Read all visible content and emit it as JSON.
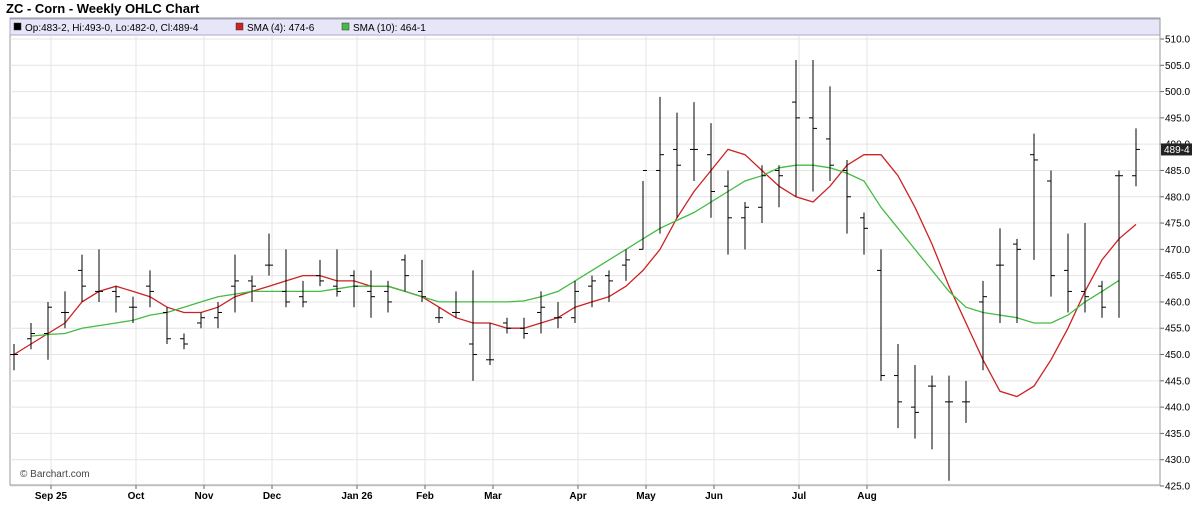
{
  "chart_data": {
    "type": "ohlc",
    "title": "ZC - Corn - Weekly OHLC Chart",
    "legend": [
      {
        "label": "Op:483-2, Hi:493-0, Lo:482-0, Cl:489-4",
        "color": "#000000"
      },
      {
        "label": "SMA (4): 474-6",
        "color": "#cc2222"
      },
      {
        "label": "SMA (10): 464-1",
        "color": "#44bb44"
      }
    ],
    "watermark": "© Barchart.com",
    "last_price_label": "489-4",
    "ylim": [
      425,
      510
    ],
    "yticks": [
      {
        "value": 510,
        "label": "510.0"
      },
      {
        "value": 505,
        "label": "505.0"
      },
      {
        "value": 500,
        "label": "500.0"
      },
      {
        "value": 495,
        "label": "495.0"
      },
      {
        "value": 490,
        "label": "490.0"
      },
      {
        "value": 485,
        "label": "485.0"
      },
      {
        "value": 480,
        "label": "480.0"
      },
      {
        "value": 475,
        "label": "475.0"
      },
      {
        "value": 470,
        "label": "470.0"
      },
      {
        "value": 465,
        "label": "465.0"
      },
      {
        "value": 460,
        "label": "460.0"
      },
      {
        "value": 455,
        "label": "455.0"
      },
      {
        "value": 450,
        "label": "450.0"
      },
      {
        "value": 445,
        "label": "445.0"
      },
      {
        "value": 440,
        "label": "440.0"
      },
      {
        "value": 435,
        "label": "435.0"
      },
      {
        "value": 430,
        "label": "430.0"
      },
      {
        "value": 425,
        "label": "425.0"
      }
    ],
    "xticks": [
      {
        "index": 2,
        "label": "Sep 25"
      },
      {
        "index": 7,
        "label": "Oct"
      },
      {
        "index": 11,
        "label": "Nov"
      },
      {
        "index": 15,
        "label": "Dec"
      },
      {
        "index": 20,
        "label": "Jan 26"
      },
      {
        "index": 24,
        "label": "Feb"
      },
      {
        "index": 28,
        "label": "Mar"
      },
      {
        "index": 33,
        "label": "Apr"
      },
      {
        "index": 37,
        "label": "May"
      },
      {
        "index": 41,
        "label": "Jun"
      },
      {
        "index": 46,
        "label": "Jul"
      },
      {
        "index": 50,
        "label": "Aug"
      }
    ],
    "ohlc": [
      [
        450,
        452,
        447,
        450
      ],
      [
        453,
        456,
        451,
        454
      ],
      [
        454,
        460,
        449,
        459
      ],
      [
        458,
        462,
        455,
        458
      ],
      [
        466,
        469,
        460,
        463
      ],
      [
        462,
        470,
        460,
        462
      ],
      [
        462,
        463,
        458,
        461
      ],
      [
        459,
        461,
        456,
        459
      ],
      [
        463,
        466,
        459,
        462
      ],
      [
        458,
        459,
        452,
        453
      ],
      [
        453,
        454,
        451,
        452
      ],
      [
        456,
        458,
        455,
        457
      ],
      [
        457,
        460,
        455,
        458
      ],
      [
        463,
        469,
        458,
        464
      ],
      [
        464,
        465,
        460,
        463
      ],
      [
        467,
        473,
        465,
        467
      ],
      [
        462,
        470,
        459,
        460
      ],
      [
        461,
        464,
        459,
        460
      ],
      [
        465,
        468,
        463,
        464
      ],
      [
        463,
        470,
        461,
        462
      ],
      [
        465,
        466,
        459,
        463
      ],
      [
        462,
        466,
        457,
        461
      ],
      [
        462,
        464,
        458,
        460
      ],
      [
        468,
        469,
        462,
        465
      ],
      [
        462,
        468,
        460,
        461
      ],
      [
        457,
        459,
        456,
        457
      ],
      [
        458,
        462,
        457,
        458
      ],
      [
        452,
        466,
        445,
        450
      ],
      [
        449,
        456,
        448,
        449
      ],
      [
        456,
        457,
        454,
        455
      ],
      [
        455,
        457,
        453,
        454
      ],
      [
        458,
        462,
        454,
        459
      ],
      [
        457,
        460,
        455,
        457
      ],
      [
        457,
        464,
        456,
        462
      ],
      [
        463,
        465,
        459,
        464
      ],
      [
        465,
        466,
        460,
        464
      ],
      [
        467,
        470,
        464,
        468
      ],
      [
        470,
        483,
        470,
        485
      ],
      [
        485,
        499,
        473,
        488
      ],
      [
        489,
        496,
        476,
        486
      ],
      [
        489,
        498,
        483,
        489
      ],
      [
        488,
        494,
        476,
        481
      ],
      [
        482,
        485,
        469,
        476
      ],
      [
        476,
        479,
        470,
        478
      ],
      [
        478,
        486,
        475,
        484
      ],
      [
        485,
        486,
        478,
        484
      ],
      [
        498,
        506,
        480,
        495
      ],
      [
        495,
        506,
        481,
        493
      ],
      [
        491,
        501,
        483,
        486
      ],
      [
        485,
        487,
        473,
        480
      ],
      [
        476,
        477,
        469,
        474
      ],
      [
        466,
        470,
        445,
        446
      ],
      [
        446,
        452,
        436,
        441
      ],
      [
        440,
        448,
        434,
        439
      ],
      [
        444,
        446,
        432,
        444
      ],
      [
        441,
        446,
        426,
        441
      ],
      [
        441,
        445,
        437,
        441
      ],
      [
        460,
        464,
        447,
        461
      ],
      [
        467,
        474,
        456,
        467
      ],
      [
        471,
        472,
        456,
        470
      ],
      [
        488,
        492,
        468,
        487
      ],
      [
        483,
        485,
        461,
        465
      ],
      [
        466,
        473,
        458,
        462
      ],
      [
        462,
        475,
        458,
        461
      ],
      [
        463,
        464,
        457,
        459
      ],
      [
        484,
        485,
        457,
        484
      ],
      [
        484,
        493,
        482,
        489
      ]
    ],
    "series": [
      {
        "name": "SMA (4)",
        "color": "#cc2222",
        "values": [
          450,
          452,
          454,
          456,
          460,
          462,
          463,
          462,
          461,
          459,
          458,
          458,
          459,
          461,
          462,
          463,
          464,
          465,
          465,
          464,
          464,
          463,
          463,
          462,
          461,
          459,
          457,
          456,
          456,
          455,
          455,
          456,
          457,
          459,
          460,
          461,
          463,
          466,
          470,
          476,
          481,
          485,
          489,
          488,
          485,
          482,
          480,
          479,
          482,
          486,
          488,
          488,
          484,
          478,
          471,
          463,
          456,
          449,
          443,
          442,
          444,
          449,
          455,
          462,
          468,
          472,
          474.75
        ],
        "start": 0
      },
      {
        "name": "SMA (10)",
        "color": "#44bb44",
        "values": [
          453.5,
          453.8,
          454,
          455,
          455.5,
          456,
          456.5,
          457.5,
          458,
          459,
          460,
          461,
          461.5,
          462,
          462,
          462,
          462,
          462,
          462.5,
          463,
          463,
          463,
          462,
          461,
          460,
          460,
          460,
          460,
          460,
          460.2,
          461,
          462,
          464,
          466,
          468,
          470,
          472,
          474,
          475.5,
          477,
          479,
          481,
          483,
          484,
          485.5,
          486,
          486,
          485.5,
          484.5,
          483,
          478,
          474,
          470,
          466,
          462,
          459,
          458,
          457.5,
          457,
          456,
          456,
          457.5,
          460,
          462,
          464.1
        ],
        "start": 1
      }
    ]
  }
}
